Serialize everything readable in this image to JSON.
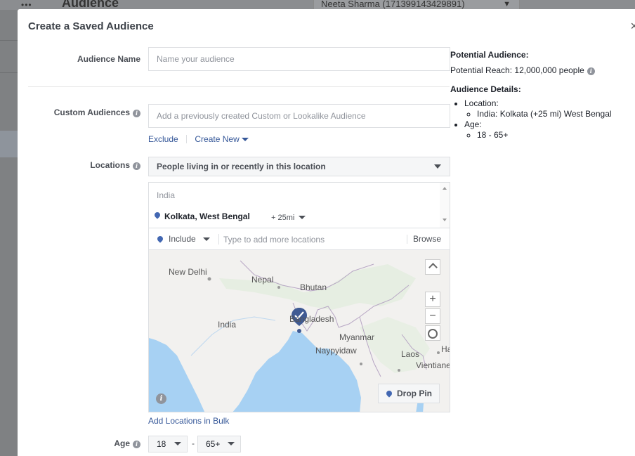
{
  "background": {
    "title": "Audience",
    "account_selector": "Neeta Sharma (171399143429891)"
  },
  "modal": {
    "title": "Create a Saved Audience",
    "close_glyph": "×"
  },
  "audience_name": {
    "label": "Audience Name",
    "placeholder": "Name your audience",
    "value": ""
  },
  "custom_audiences": {
    "label": "Custom Audiences",
    "placeholder": "Add a previously created Custom or Lookalike Audience",
    "exclude_label": "Exclude",
    "create_new_label": "Create New"
  },
  "locations": {
    "label": "Locations",
    "type_select": "People living in or recently in this location",
    "country": "India",
    "selected_location": "Kolkata, West Bengal",
    "radius": "+ 25mi",
    "include_label": "Include",
    "search_placeholder": "Type to add more locations",
    "browse_label": "Browse",
    "add_bulk_label": "Add Locations in Bulk"
  },
  "map": {
    "labels": {
      "new_delhi": "New Delhi",
      "nepal": "Nepal",
      "bhutan": "Bhutan",
      "india": "India",
      "bangladesh": "Bangladesh",
      "myanmar": "Myanmar",
      "naypyidaw": "Naypyidaw",
      "laos": "Laos",
      "vientiane": "Vientiane",
      "ha": "Ha"
    },
    "zoom_in": "+",
    "zoom_out": "−",
    "collapse_glyph": "^",
    "drop_pin_label": "Drop Pin",
    "colors": {
      "water": "#a7d1f3",
      "land": "#f2f1ef",
      "pin": "#3f5a93"
    }
  },
  "age": {
    "label": "Age",
    "min": "18",
    "max": "65+",
    "dash": "-"
  },
  "potential_audience": {
    "heading": "Potential Audience:",
    "reach": "Potential Reach: 12,000,000 people",
    "details_heading": "Audience Details:",
    "location_label": "Location:",
    "location_value": "India: Kolkata (+25 mi) West Bengal",
    "age_label": "Age:",
    "age_value": "18 - 65+"
  },
  "colors": {
    "link": "#365899",
    "accent": "#4267b2",
    "label_text": "#4b4f56",
    "placeholder": "#90949c"
  }
}
